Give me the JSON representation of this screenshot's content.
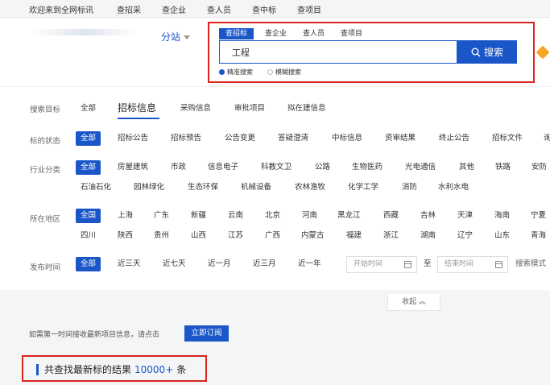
{
  "topnav": [
    "欢迎来到全网标讯",
    "查招采",
    "查企业",
    "查人员",
    "查中标",
    "查项目"
  ],
  "header": {
    "branch": "分站",
    "search_tabs": [
      "查招标",
      "查企业",
      "查人员",
      "查项目"
    ],
    "search_value": "工程",
    "search_button": "搜索",
    "modes": [
      "精准搜索",
      "模糊搜索"
    ]
  },
  "filters": {
    "target": {
      "label": "搜索目标",
      "options": [
        "全部",
        "招标信息",
        "采购信息",
        "审批项目",
        "拟在建信息"
      ]
    },
    "status": {
      "label": "标的状态",
      "options": [
        "全部",
        "招标公告",
        "招标预告",
        "公告变更",
        "答疑澄清",
        "中标信息",
        "资审结果",
        "终止公告",
        "招标文件",
        "询"
      ]
    },
    "industry": {
      "label": "行业分类",
      "row1": [
        "全部",
        "房屋建筑",
        "市政",
        "信息电子",
        "科教文卫",
        "公路",
        "生物医药",
        "光电通信",
        "其他",
        "铁路",
        "安防"
      ],
      "row2": [
        "石油石化",
        "园林绿化",
        "生态环保",
        "机械设备",
        "农林渔牧",
        "化学工学",
        "消防",
        "水利水电"
      ]
    },
    "region": {
      "label": "所在地区",
      "row1": [
        "全国",
        "上海",
        "广东",
        "新疆",
        "云南",
        "北京",
        "河南",
        "黑龙江",
        "西藏",
        "吉林",
        "天津",
        "海南",
        "宁夏"
      ],
      "row2": [
        "四川",
        "陕西",
        "贵州",
        "山西",
        "江苏",
        "广西",
        "内蒙古",
        "福建",
        "浙江",
        "湖南",
        "辽宁",
        "山东",
        "青海"
      ]
    },
    "time": {
      "label": "发布时间",
      "options": [
        "全部",
        "近三天",
        "近七天",
        "近一月",
        "近三月",
        "近一年"
      ],
      "start_placeholder": "开始时间",
      "to": "至",
      "end_placeholder": "结束时间",
      "search_mode": "搜索模式"
    }
  },
  "collapse": "收起 ︽",
  "notice": "如需第一时间接收最新项目信息，请点击",
  "subscribe": "立即订阅",
  "result": {
    "prefix": "共查找最新标的结果",
    "count": "10000+",
    "suffix": "条"
  },
  "colors": {
    "primary": "#1a56c8",
    "highlight": "#d9251c"
  }
}
